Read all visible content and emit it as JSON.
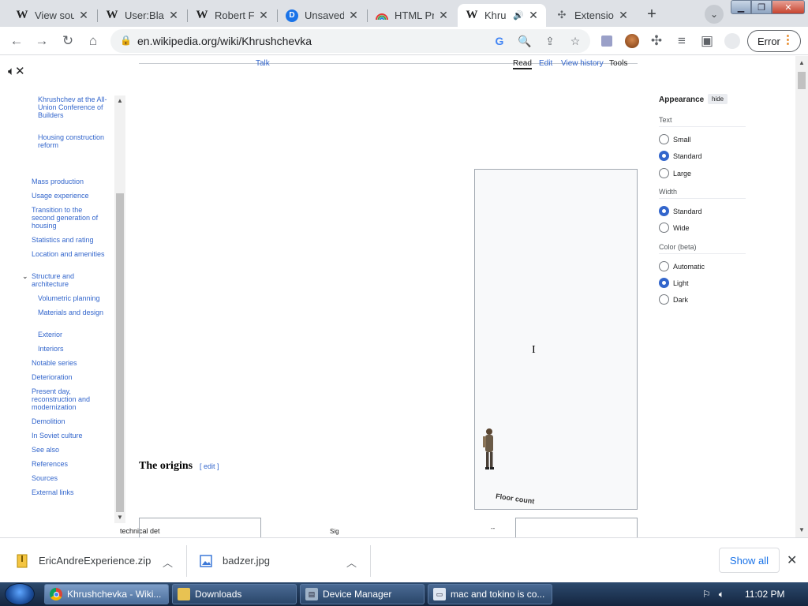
{
  "tabs": [
    {
      "title": "View sou",
      "favicon": "W"
    },
    {
      "title": "User:Blat",
      "favicon": "W"
    },
    {
      "title": "Robert F",
      "favicon": "W"
    },
    {
      "title": "Unsaved",
      "favicon": "D"
    },
    {
      "title": "HTML Pr",
      "favicon": "rainbow"
    },
    {
      "title": "Khru",
      "favicon": "W",
      "active": true,
      "audio": true
    },
    {
      "title": "Extensio",
      "favicon": "puzzle"
    }
  ],
  "address": {
    "url": "en.wikipedia.org/wiki/Khrushchevka"
  },
  "profile_button": "Error",
  "article": {
    "top_tabs": [
      "Talk",
      "Read",
      "Edit",
      "View history",
      "Tools"
    ],
    "figure_caption": "Floor count",
    "section_heading": "The origins",
    "section_edit": "[ edit ]",
    "clipped_text": [
      "technical det",
      "Sig",
      "--"
    ]
  },
  "toc": [
    {
      "label": "Khrushchev at the All-Union Conference of Builders",
      "level": 3
    },
    {
      "label": "Housing construction reform",
      "level": 3
    },
    {
      "label": "Mass production",
      "level": 2
    },
    {
      "label": "Usage experience",
      "level": 2
    },
    {
      "label": "Transition to the second generation of housing",
      "level": 2
    },
    {
      "label": "Statistics and rating",
      "level": 2
    },
    {
      "label": "Location and amenities",
      "level": 2
    },
    {
      "label": "Structure and architecture",
      "level": 2,
      "expanded": true
    },
    {
      "label": "Volumetric planning",
      "level": 3
    },
    {
      "label": "Materials and design",
      "level": 3
    },
    {
      "label": "Exterior",
      "level": 3
    },
    {
      "label": "Interiors",
      "level": 3
    },
    {
      "label": "Notable series",
      "level": 2
    },
    {
      "label": "Deterioration",
      "level": 2
    },
    {
      "label": "Present day, reconstruction and modernization",
      "level": 2
    },
    {
      "label": "Demolition",
      "level": 2
    },
    {
      "label": "In Soviet culture",
      "level": 2
    },
    {
      "label": "See also",
      "level": 2
    },
    {
      "label": "References",
      "level": 2
    },
    {
      "label": "Sources",
      "level": 2
    },
    {
      "label": "External links",
      "level": 2
    }
  ],
  "appearance": {
    "title": "Appearance",
    "hide": "hide",
    "text_label": "Text",
    "text_options": [
      "Small",
      "Standard",
      "Large"
    ],
    "text_selected": "Standard",
    "width_label": "Width",
    "width_options": [
      "Standard",
      "Wide"
    ],
    "width_selected": "Standard",
    "color_label": "Color (beta)",
    "color_options": [
      "Automatic",
      "Light",
      "Dark"
    ],
    "color_selected": "Light"
  },
  "downloads": [
    {
      "name": "EricAndreExperience.zip",
      "icon": "zip-file-icon"
    },
    {
      "name": "badzer.jpg",
      "icon": "image-file-icon"
    }
  ],
  "show_all": "Show all",
  "taskbar": [
    {
      "label": "Khrushchevka - Wiki...",
      "icon": "chrome-icon",
      "active": true
    },
    {
      "label": "Downloads",
      "icon": "folder-icon"
    },
    {
      "label": "Device Manager",
      "icon": "device-manager-icon"
    },
    {
      "label": "mac and tokino is co...",
      "icon": "chat-icon"
    }
  ],
  "clock": "11:02 PM"
}
